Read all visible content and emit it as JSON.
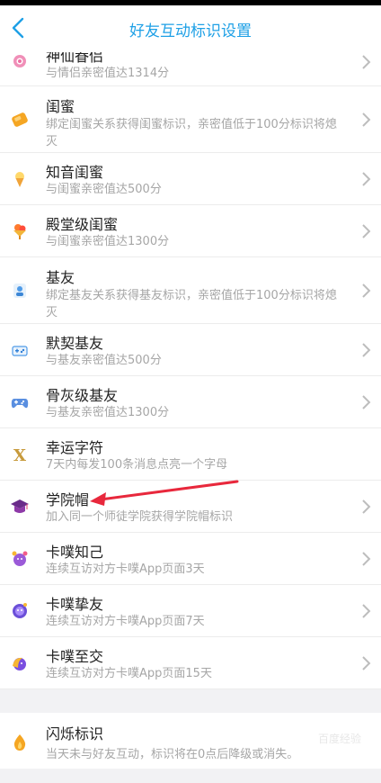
{
  "header": {
    "title": "好友互动标识设置"
  },
  "items": [
    {
      "name": "神仙眷侣",
      "desc": "与情侣亲密值达1314分",
      "icon": "couple-icon"
    },
    {
      "name": "闺蜜",
      "desc": "绑定闺蜜关系获得闺蜜标识，亲密值低于100分标识将熄灭",
      "icon": "bestie-icon"
    },
    {
      "name": "知音闺蜜",
      "desc": "与闺蜜亲密值达500分",
      "icon": "ice-cream-icon"
    },
    {
      "name": "殿堂级闺蜜",
      "desc": "与闺蜜亲密值达1300分",
      "icon": "parfait-icon"
    },
    {
      "name": "基友",
      "desc": "绑定基友关系获得基友标识，亲密值低于100分标识将熄灭",
      "icon": "bro-icon"
    },
    {
      "name": "默契基友",
      "desc": "与基友亲密值达500分",
      "icon": "controller-icon"
    },
    {
      "name": "骨灰级基友",
      "desc": "与基友亲密值达1300分",
      "icon": "gamepad-icon"
    },
    {
      "name": "幸运字符",
      "desc": "7天内每发100条消息点亮一个字母",
      "icon": "x-letter-icon"
    },
    {
      "name": "学院帽",
      "desc": "加入同一个师徒学院获得学院帽标识",
      "icon": "graduation-cap-icon"
    },
    {
      "name": "卡噗知己",
      "desc": "连续互访对方卡噗App页面3天",
      "icon": "kapu-purple-icon"
    },
    {
      "name": "卡噗挚友",
      "desc": "连续互访对方卡噗App页面7天",
      "icon": "kapu-violet-icon"
    },
    {
      "name": "卡噗至交",
      "desc": "连续互访对方卡噗App页面15天",
      "icon": "kapu-gold-icon"
    }
  ],
  "flash": {
    "name": "闪烁标识",
    "desc": "当天未与好友互动，标识将在0点后降级或消失。",
    "icon": "flame-drop-icon"
  },
  "watermark": "百度经验",
  "colors": {
    "accent": "#1ea0e6",
    "arrow": "#e8283c"
  }
}
